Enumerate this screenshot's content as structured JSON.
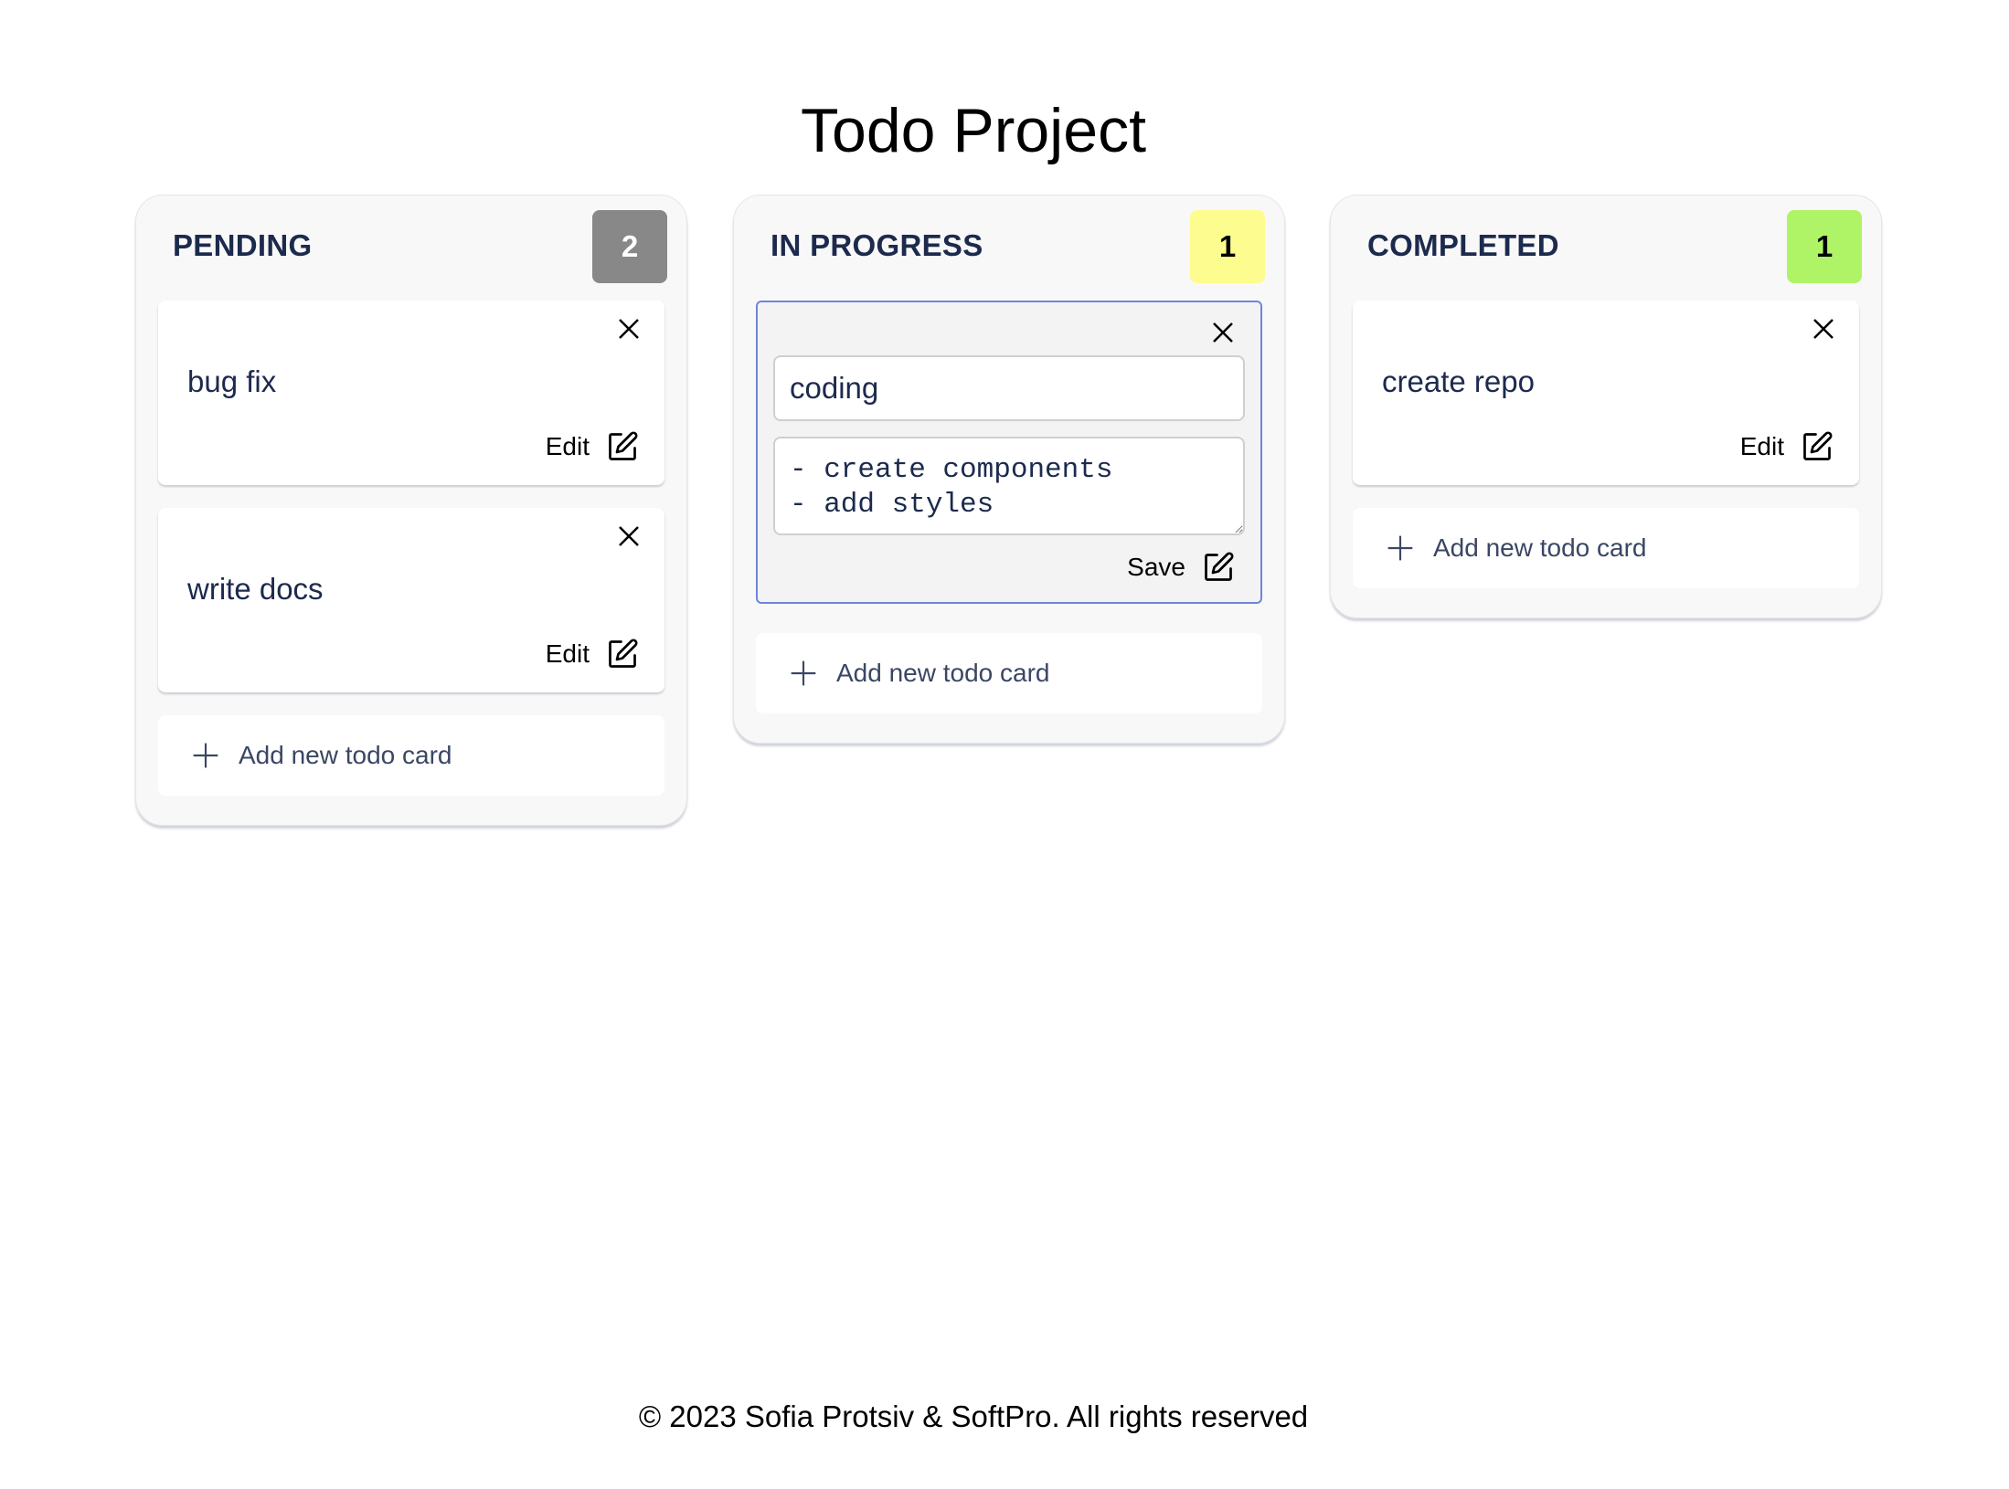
{
  "header": {
    "title": "Todo Project"
  },
  "columns": [
    {
      "title": "PENDING",
      "count": "2",
      "badge_color": "#888888",
      "badge_text_color": "#ffffff",
      "cards": [
        {
          "title": "bug fix",
          "action_label": "Edit"
        },
        {
          "title": "write docs",
          "action_label": "Edit"
        }
      ],
      "add_label": "Add new todo card"
    },
    {
      "title": "IN PROGRESS",
      "count": "1",
      "badge_color": "#fdfd8f",
      "badge_text_color": "#000000",
      "editing_card": {
        "title_value": "coding",
        "description_value": "- create components\n- add styles",
        "action_label": "Save"
      },
      "add_label": "Add new todo card"
    },
    {
      "title": "COMPLETED",
      "count": "1",
      "badge_color": "#aff467",
      "badge_text_color": "#000000",
      "cards": [
        {
          "title": "create repo",
          "action_label": "Edit"
        }
      ],
      "add_label": "Add new todo card"
    }
  ],
  "icons": {
    "close": "close-icon",
    "edit": "pencil-square-icon",
    "add": "plus-icon"
  },
  "colors": {
    "accent_border": "#6f84df",
    "heading_text": "#1c2a4d"
  },
  "footer": {
    "text": "© 2023 Sofia Protsiv & SoftPro. All rights reserved"
  }
}
